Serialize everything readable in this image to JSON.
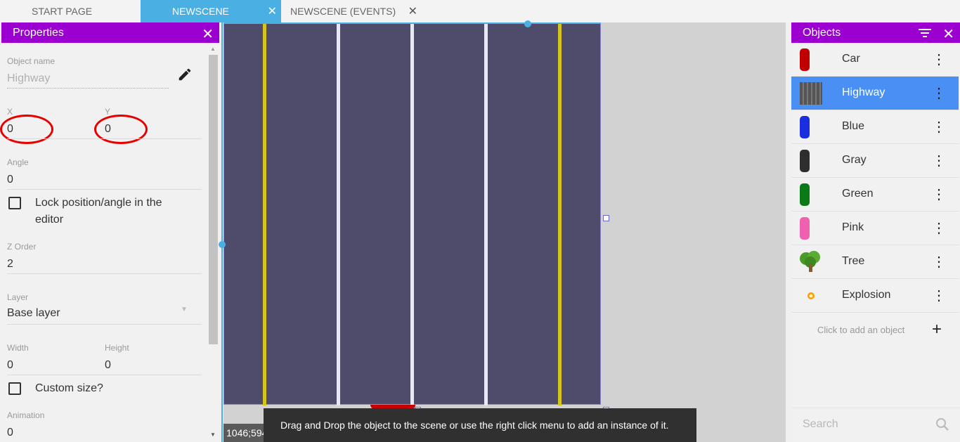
{
  "tabs": [
    {
      "label": "START PAGE",
      "active": false,
      "closable": false
    },
    {
      "label": "NEWSCENE",
      "active": true,
      "closable": true
    },
    {
      "label": "NEWSCENE (EVENTS)",
      "active": false,
      "closable": true
    }
  ],
  "properties": {
    "title": "Properties",
    "object_name_label": "Object name",
    "object_name_placeholder": "Highway",
    "x_label": "X",
    "x_value": "0",
    "y_label": "Y",
    "y_value": "0",
    "angle_label": "Angle",
    "angle_value": "0",
    "lock_label_line1": "Lock position/angle in the",
    "lock_label_line2": "editor",
    "zorder_label": "Z Order",
    "zorder_value": "2",
    "layer_label": "Layer",
    "layer_value": "Base layer",
    "width_label": "Width",
    "width_value": "0",
    "height_label": "Height",
    "height_value": "0",
    "custom_size_label": "Custom size?",
    "animation_label": "Animation",
    "animation_value": "0"
  },
  "scene": {
    "coordinates": "1046;594",
    "tooltip": "Drag and Drop the object to the scene or use the right click menu to add an instance of it."
  },
  "objects": {
    "title": "Objects",
    "items": [
      {
        "label": "Car",
        "selected": false,
        "color": "#c00000",
        "icon": "car-icon"
      },
      {
        "label": "Highway",
        "selected": true,
        "color": "#555555",
        "icon": "highway-icon"
      },
      {
        "label": "Blue",
        "selected": false,
        "color": "#1a2ee0",
        "icon": "car-icon"
      },
      {
        "label": "Gray",
        "selected": false,
        "color": "#2e2e2e",
        "icon": "car-icon"
      },
      {
        "label": "Green",
        "selected": false,
        "color": "#0a7a16",
        "icon": "car-icon"
      },
      {
        "label": "Pink",
        "selected": false,
        "color": "#f060b0",
        "icon": "car-icon"
      },
      {
        "label": "Tree",
        "selected": false,
        "color": "#4a9a2a",
        "icon": "tree-icon"
      },
      {
        "label": "Explosion",
        "selected": false,
        "color": "#ff9a00",
        "icon": "explosion-icon"
      }
    ],
    "add_label": "Click to add an object",
    "search_placeholder": "Search"
  }
}
